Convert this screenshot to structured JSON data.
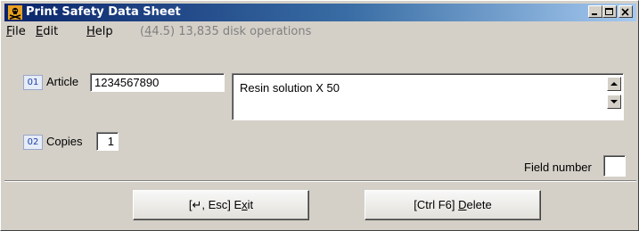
{
  "window": {
    "title": "Print Safety Data Sheet",
    "app_icon": "hazard-icon"
  },
  "titlebar_buttons": [
    "minimize-icon",
    "maximize-icon",
    "close-icon"
  ],
  "menu": {
    "file": {
      "accel": "F",
      "rest": "ile"
    },
    "edit": {
      "accel": "E",
      "rest": "dit"
    },
    "help": {
      "accel": "H",
      "rest": "elp"
    }
  },
  "status": {
    "pre": "(",
    "accel": "4",
    "post": "4.5) 13,835 disk operations"
  },
  "fields": {
    "article": {
      "number": "01",
      "label": "Article",
      "value": "1234567890",
      "description": "Resin solution X 50"
    },
    "copies": {
      "number": "02",
      "label": "Copies",
      "value": "1"
    },
    "field_number": {
      "label": "Field number",
      "value": ""
    }
  },
  "buttons": {
    "exit": {
      "pre": "[↵, Esc] E",
      "accel": "x",
      "post": "it"
    },
    "delete": {
      "pre": "[Ctrl F6] ",
      "accel": "D",
      "post": "elete"
    }
  },
  "colors": {
    "title_start": "#0a246a",
    "title_end": "#a6caf0",
    "face": "#d4d0c8",
    "badge_text": "#1a3fa8"
  }
}
